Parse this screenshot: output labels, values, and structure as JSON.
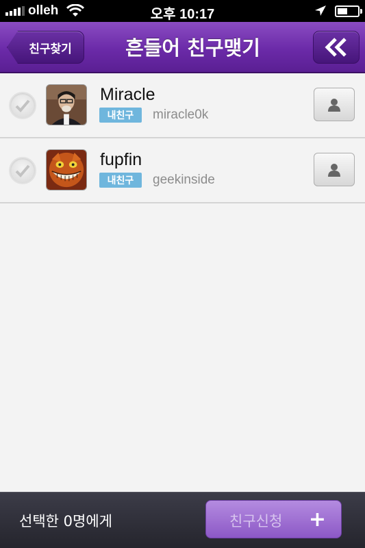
{
  "status_bar": {
    "carrier": "olleh",
    "time": "오후 10:17"
  },
  "nav": {
    "back_label": "친구찾기",
    "title": "흔들어 친구맺기"
  },
  "friends": [
    {
      "name": "Miracle",
      "badge": "내친구",
      "id": "miracle0k",
      "avatar": "person-photo"
    },
    {
      "name": "fupfin",
      "badge": "내친구",
      "id": "geekinside",
      "avatar": "grinning-cat-illustration"
    }
  ],
  "footer": {
    "selection_text": "선택한 0명에게",
    "request_label": "친구신청",
    "plus": "+"
  },
  "colors": {
    "nav_purple": "#6b2aa8",
    "badge_blue": "#6fb6dd",
    "request_button": "#a070d4"
  },
  "icons": [
    "signal-icon",
    "wifi-icon",
    "location-icon",
    "battery-icon",
    "double-chevron-left-icon",
    "check-icon",
    "person-icon",
    "plus-icon"
  ]
}
